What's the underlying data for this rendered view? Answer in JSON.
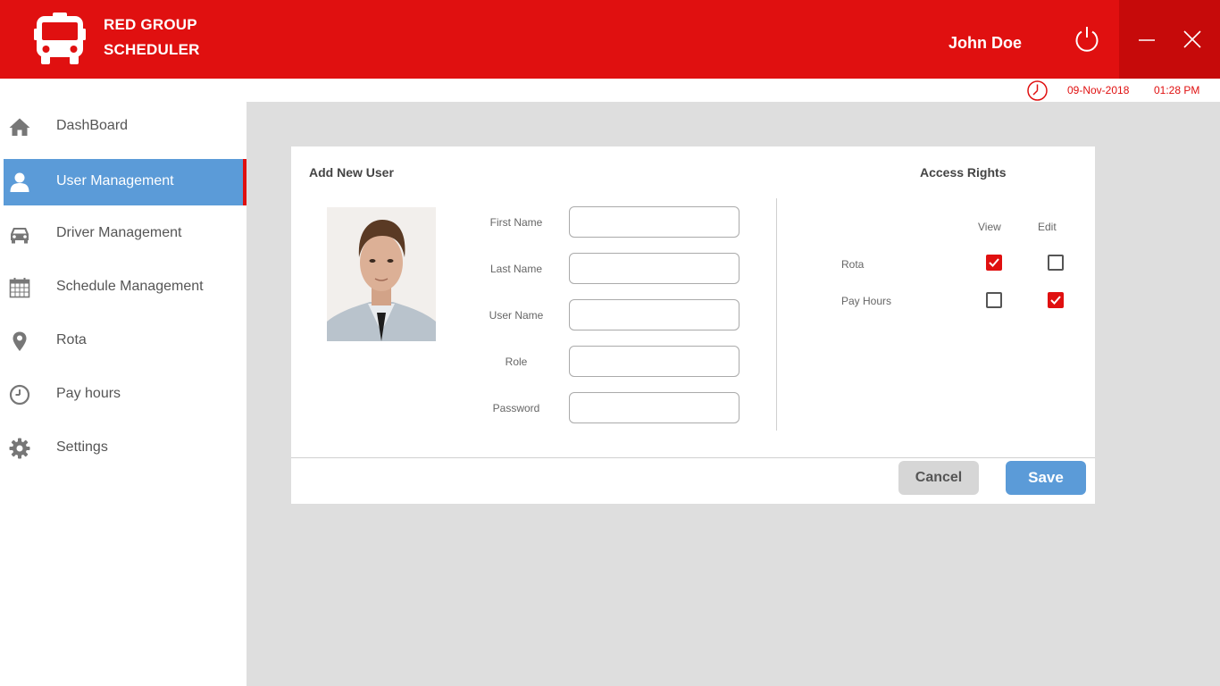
{
  "header": {
    "app_title_line1": "RED GROUP",
    "app_title_line2": "SCHEDULER",
    "username": "John Doe",
    "brand_color": "#e01010",
    "icons": [
      "bus-icon",
      "power-icon",
      "minimize-icon",
      "close-icon"
    ]
  },
  "datetime": {
    "date": "09-Nov-2018",
    "time": "01:28 PM",
    "icon": "clock-icon"
  },
  "sidebar": {
    "items": [
      {
        "label": "DashBoard",
        "icon": "home-icon",
        "active": false
      },
      {
        "label": "User Management",
        "icon": "user-icon",
        "active": true
      },
      {
        "label": "Driver Management",
        "icon": "car-icon",
        "active": false
      },
      {
        "label": "Schedule Management",
        "icon": "calendar-icon",
        "active": false
      },
      {
        "label": "Rota",
        "icon": "map-pin-icon",
        "active": false
      },
      {
        "label": "Pay hours",
        "icon": "clock-icon",
        "active": false
      },
      {
        "label": "Settings",
        "icon": "gear-icon",
        "active": false
      }
    ],
    "active_color": "#5b9bd8"
  },
  "form": {
    "title": "Add  New User",
    "fields": [
      {
        "label": "First Name",
        "value": ""
      },
      {
        "label": "Last Name",
        "value": ""
      },
      {
        "label": "User Name",
        "value": ""
      },
      {
        "label": "Role",
        "value": ""
      },
      {
        "label": "Password",
        "value": ""
      }
    ]
  },
  "access_rights": {
    "title": "Access Rights",
    "columns": [
      "View",
      "Edit"
    ],
    "rows": [
      {
        "label": "Rota",
        "view": true,
        "edit": false
      },
      {
        "label": "Pay Hours",
        "view": false,
        "edit": true
      }
    ]
  },
  "actions": {
    "cancel_label": "Cancel",
    "save_label": "Save"
  }
}
